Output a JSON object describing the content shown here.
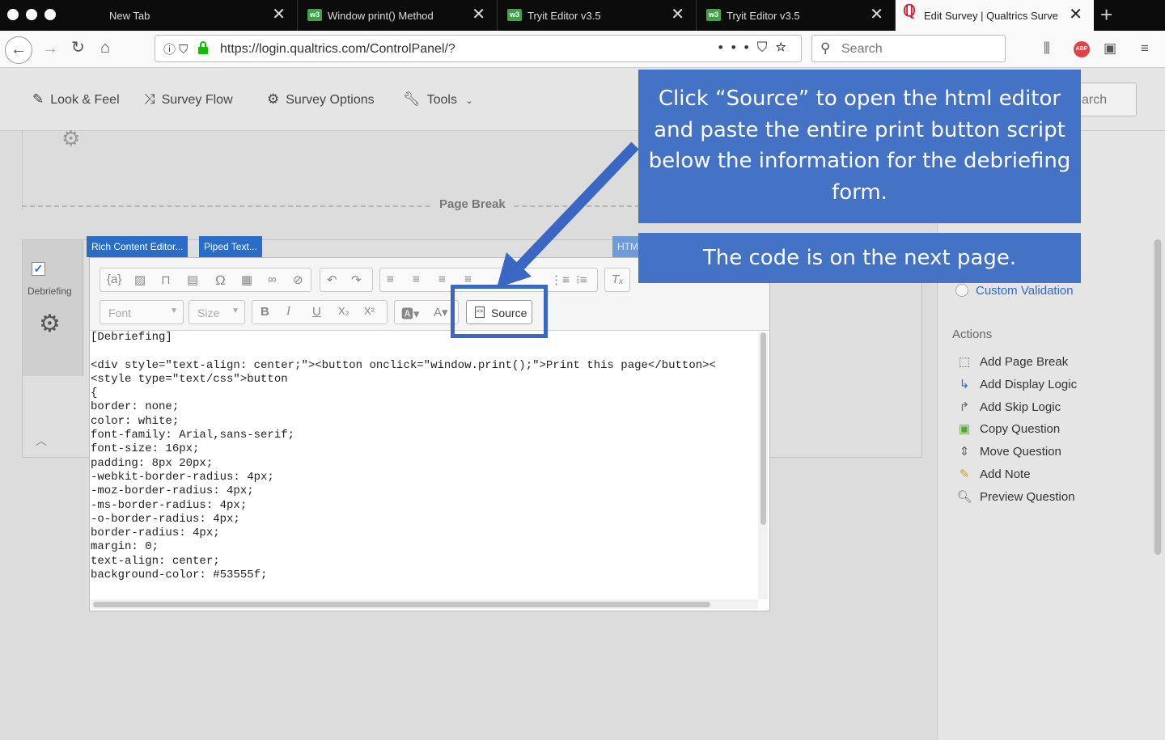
{
  "browser": {
    "tabs": [
      {
        "title": "New Tab",
        "favicon": ""
      },
      {
        "title": "Window print() Method",
        "favicon": "w3"
      },
      {
        "title": "Tryit Editor v3.5",
        "favicon": "w3"
      },
      {
        "title": "Tryit Editor v3.5",
        "favicon": "w3"
      },
      {
        "title": "Edit Survey | Qualtrics Survey",
        "favicon": "qualtrics-icon"
      }
    ],
    "url": "https://login.qualtrics.com/ControlPanel/?",
    "search_placeholder": "Search",
    "abp_badge": "ABP"
  },
  "app_toolbar": {
    "items": [
      "Look & Feel",
      "Survey Flow",
      "Survey Options",
      "Tools"
    ],
    "search_partial": "arch"
  },
  "survey": {
    "page_break_label": "Page Break",
    "question_label": "Debriefing",
    "editor_tabs": [
      "Rich Content Editor...",
      "Piped Text...",
      "HTM"
    ],
    "toolbar": {
      "font_label": "Font",
      "size_label": "Size",
      "source_label": "Source"
    },
    "code_lines": [
      "[Debriefing]",
      "",
      "<div style=\"text-align: center;\"><button onclick=\"window.print();\">Print this page</button><",
      "<style type=\"text/css\">button",
      "{",
      "border: none;",
      "color: white;",
      "font-family: Arial,sans-serif;",
      "font-size: 16px;",
      "padding: 8px 20px;",
      "-webkit-border-radius: 4px;",
      "-moz-border-radius: 4px;",
      "-ms-border-radius: 4px;",
      "-o-border-radius: 4px;",
      "border-radius: 4px;",
      "margin: 0;",
      "text-align: center;",
      "background-color: #53555f;"
    ]
  },
  "right_panel": {
    "custom_validation": "Custom Validation",
    "actions_heading": "Actions",
    "actions": [
      {
        "label": "Add Page Break",
        "icon": "page-break-icon"
      },
      {
        "label": "Add Display Logic",
        "icon": "display-logic-icon"
      },
      {
        "label": "Add Skip Logic",
        "icon": "skip-logic-icon"
      },
      {
        "label": "Copy Question",
        "icon": "copy-icon"
      },
      {
        "label": "Move Question",
        "icon": "move-icon"
      },
      {
        "label": "Add Note",
        "icon": "note-icon"
      },
      {
        "label": "Preview Question",
        "icon": "preview-icon"
      }
    ]
  },
  "annotations": {
    "callout_main": "Click “Source” to open the html editor and paste the entire print button script below the information for the debriefing form.",
    "callout_secondary": "The code is on the next page.",
    "accent_color": "#4472c4"
  }
}
